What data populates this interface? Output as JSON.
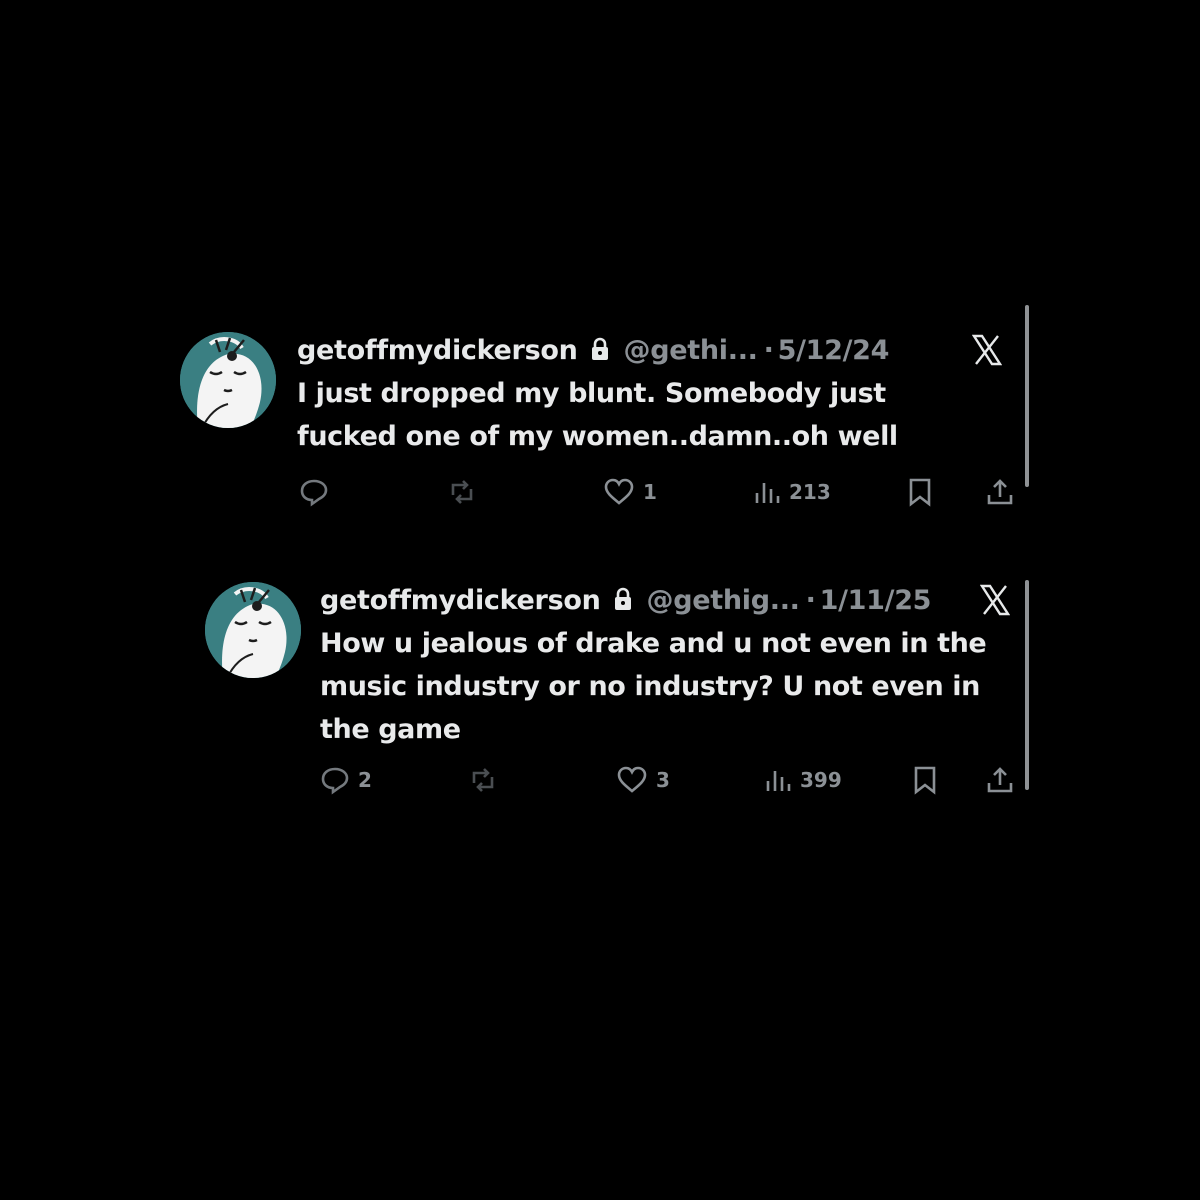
{
  "colors": {
    "background": "#000000",
    "text": "#e7e9ea",
    "muted": "#8b9095",
    "icon": "#74797e",
    "avatar_bg": "#3a7f82"
  },
  "tweets": [
    {
      "display_name": "getoffmydickerson",
      "handle": "@gethi...",
      "separator": "·",
      "date": "5/12/24",
      "text_lines": [
        "I just dropped my blunt. Somebody just",
        "fucked one of my women..damn..oh well"
      ],
      "replies": "",
      "reposts": "",
      "likes": "1",
      "views": "213",
      "icons": [
        "reply-icon",
        "repost-icon",
        "heart-icon",
        "views-icon",
        "bookmark-icon",
        "share-icon",
        "lock-icon",
        "x-logo-icon"
      ]
    },
    {
      "display_name": "getoffmydickerson",
      "handle": "@gethig...",
      "separator": "·",
      "date": "1/11/25",
      "text_lines": [
        "How u jealous of drake and u not even in the",
        "music industry or no industry? U not even in",
        "the game"
      ],
      "replies": "2",
      "reposts": "",
      "likes": "3",
      "views": "399",
      "icons": [
        "reply-icon",
        "repost-icon",
        "heart-icon",
        "views-icon",
        "bookmark-icon",
        "share-icon",
        "lock-icon",
        "x-logo-icon"
      ]
    }
  ]
}
